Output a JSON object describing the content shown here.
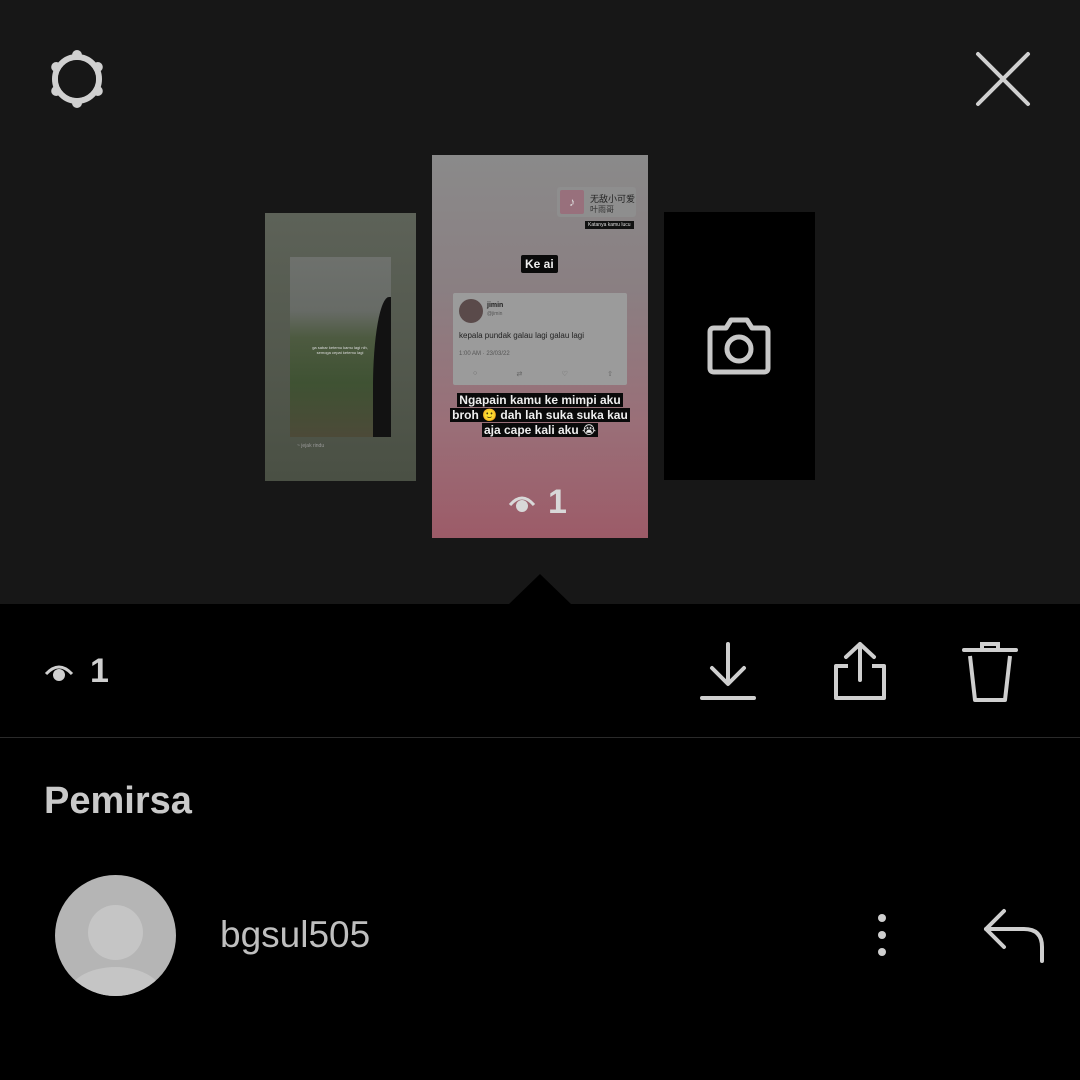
{
  "header": {
    "settings_icon": "gear-icon",
    "close_icon": "close-icon"
  },
  "stories": {
    "left_caption": "ga sabar ketemu kamu lagi nih, semoga cepat ketemu lagi",
    "left_signature": "~ jejak rindu",
    "main": {
      "music_title": "无敌小可爱",
      "music_artist": "叶雨哥",
      "music_caption": "Katanya kamu lucu",
      "sticker_text": "Ke ai",
      "tweet_name": "jimin",
      "tweet_handle": "@jimin",
      "tweet_text": "kepala pundak galau lagi galau lagi",
      "tweet_time": "1:00 AM · 23/03/22",
      "caption_line1": "Ngapain kamu ke mimpi aku",
      "caption_line2": "broh 🙂 dah lah suka suka kau",
      "caption_line3": "aja cape kali aku 😭",
      "views": "1"
    },
    "right_icon": "camera-icon"
  },
  "toolbar": {
    "views_count": "1",
    "download_icon": "download-icon",
    "share_icon": "share-icon",
    "delete_icon": "trash-icon"
  },
  "viewers": {
    "title": "Pemirsa",
    "items": [
      {
        "username": "bgsul505"
      }
    ]
  }
}
